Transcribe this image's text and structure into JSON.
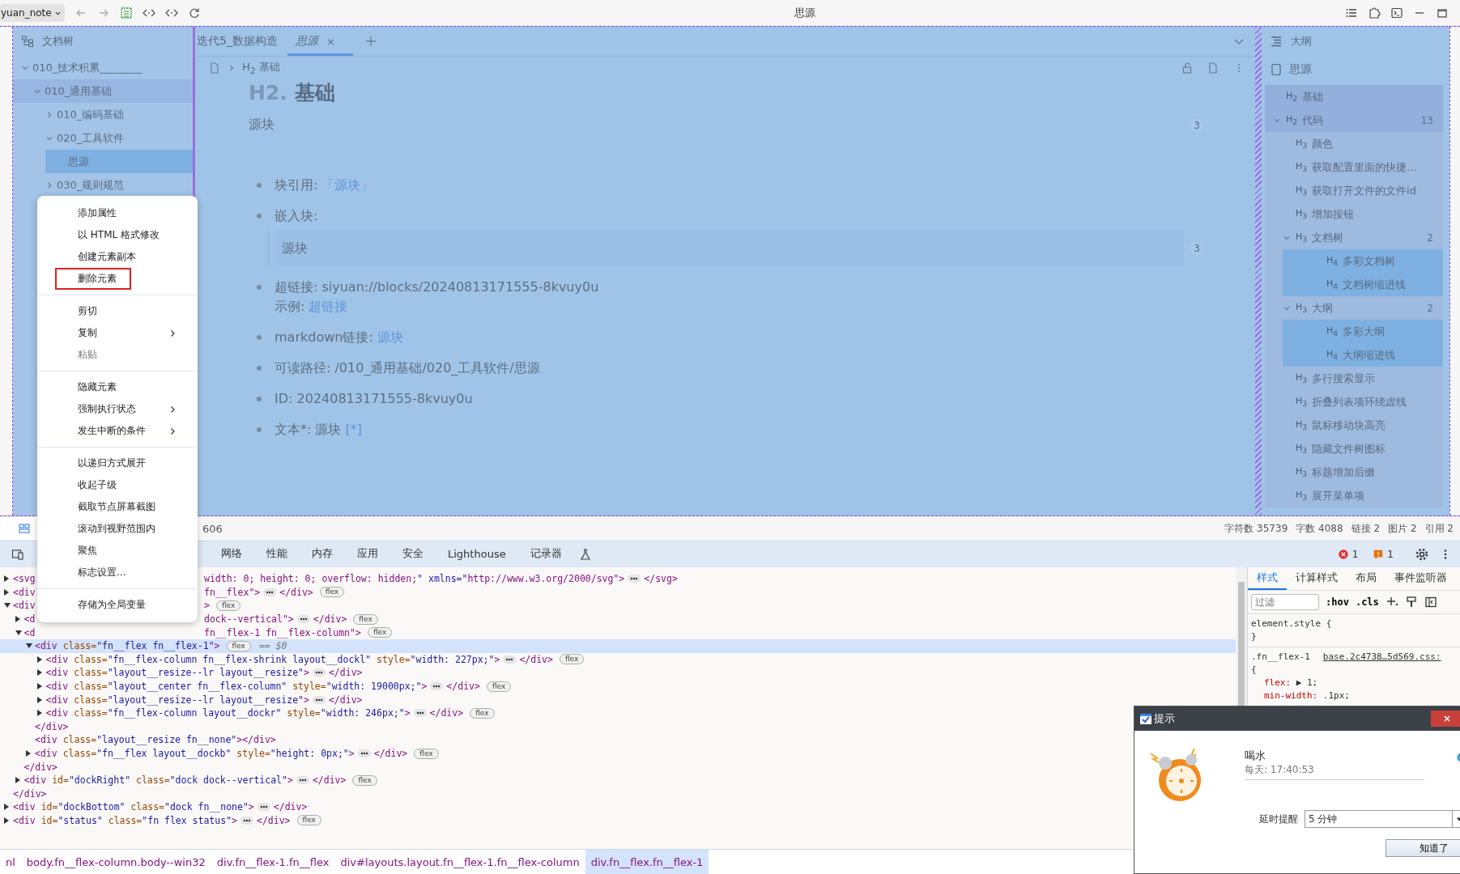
{
  "topbar": {
    "workspace": "yuan_note",
    "title": "思源"
  },
  "doc_tree": {
    "title": "文档树",
    "items": [
      {
        "label": "010_技术积累________",
        "expanded": true,
        "selected": false,
        "children": [
          {
            "label": "010_通用基础",
            "expanded": true,
            "selected": false,
            "children": [
              {
                "label": "010_编码基础",
                "expanded": false,
                "selected": false
              },
              {
                "label": "020_工具软件",
                "expanded": true,
                "selected": false,
                "children": [
                  {
                    "label": "思源",
                    "selected": true
                  }
                ]
              },
              {
                "label": "030_规则规范",
                "expanded": false,
                "selected": false
              }
            ]
          }
        ]
      }
    ]
  },
  "editor": {
    "tabs": [
      {
        "label": "迭代5_数据构造",
        "selected": false
      },
      {
        "label": "思源",
        "selected": true,
        "close": "×"
      }
    ],
    "breadcrumb": {
      "level": "H$_{2}$",
      "label": "基础"
    },
    "heading": {
      "marker": "H2.",
      "text": "基础"
    },
    "paragraph": {
      "text": "源块",
      "count": "3"
    },
    "list": [
      {
        "kind": "link",
        "label": "块引用: ",
        "link": "「源块」"
      },
      {
        "kind": "embed",
        "label": "嵌入块:",
        "embed": "源块",
        "count": "3"
      },
      {
        "kind": "note",
        "label": "超链接: siyuan://blocks/20240813171555-8kvuy0u",
        "note": "示例: ",
        "link": "超链接"
      },
      {
        "kind": "link",
        "label": "markdown链接: ",
        "link": "源块"
      },
      {
        "kind": "text",
        "label": "可读路径: /010_通用基础/020_工具软件/思源"
      },
      {
        "kind": "text",
        "label": "ID: 20240813171555-8kvuy0u"
      },
      {
        "kind": "link",
        "label": "文本*: 源块 ",
        "link": "[*]"
      }
    ]
  },
  "outline": {
    "title": "大纲",
    "doc": "思源",
    "items": [
      {
        "tag": "H$_{2}$",
        "label": "基础",
        "selected": false
      },
      {
        "tag": "H$_{2}$",
        "label": "代码",
        "count": "13",
        "expanded": true,
        "selected": false,
        "children": [
          {
            "tag": "H$_{3}$",
            "label": "颜色",
            "selected": false
          },
          {
            "tag": "H$_{3}$",
            "label": "获取配置里面的快捷…",
            "selected": false
          },
          {
            "tag": "H$_{3}$",
            "label": "获取打开文件的文件id",
            "selected": false
          },
          {
            "tag": "H$_{3}$",
            "label": "增加按钮",
            "selected": false
          },
          {
            "tag": "H$_{3}$",
            "label": "文档树",
            "count": "2",
            "expanded": true,
            "selected": false,
            "children": [
              {
                "tag": "H$_{4}$",
                "label": "多彩文档树",
                "selected": true
              },
              {
                "tag": "H$_{4}$",
                "label": "文档树缩进线",
                "selected": true
              }
            ]
          },
          {
            "tag": "H$_{3}$",
            "label": "大纲",
            "count": "2",
            "expanded": true,
            "selected": false,
            "children": [
              {
                "tag": "H$_{4}$",
                "label": "多彩大纲",
                "selected": true
              },
              {
                "tag": "H$_{4}$",
                "label": "大纲缩进线",
                "selected": true
              }
            ]
          },
          {
            "tag": "H$_{3}$",
            "label": "多行搜索显示",
            "selected": false
          },
          {
            "tag": "H$_{3}$",
            "label": "折叠列表项环绕虚线",
            "selected": false
          },
          {
            "tag": "H$_{3}$",
            "label": "鼠标移动块高亮",
            "selected": false
          },
          {
            "tag": "H$_{3}$",
            "label": "隐藏文件树图标",
            "selected": false
          },
          {
            "tag": "H$_{3}$",
            "label": "标题增加后缀",
            "selected": false
          },
          {
            "tag": "H$_{3}$",
            "label": "展开菜单项",
            "selected": false
          }
        ]
      }
    ]
  },
  "status": {
    "size": "606",
    "stats": [
      "字符数 35739",
      "字数 4088",
      "链接 2",
      "图片 2",
      "引用 2"
    ]
  },
  "devtools": {
    "tabs": [
      {
        "label": "网络",
        "selected": false
      },
      {
        "label": "性能",
        "selected": false
      },
      {
        "label": "内存",
        "selected": false
      },
      {
        "label": "应用",
        "selected": false
      },
      {
        "label": "安全",
        "selected": false
      },
      {
        "label": "Lighthouse",
        "selected": false
      },
      {
        "label": "记录器",
        "selected": false
      }
    ],
    "errors": "1",
    "warnings": "1",
    "dom": [
      {
        "left": "<svg",
        "right": "width: 0; height: 0; overflow: hidden;\" xmlns=\"http://www.w3.org/2000/svg\">",
        "expanded": false,
        "more": true,
        "end": "</svg>",
        "selected": false
      },
      {
        "left": "<div",
        "right": "fn__flex\">",
        "expanded": false,
        "more": true,
        "end": "</div>",
        "badge": "flex",
        "selected": false
      },
      {
        "left": "<div",
        "right": ">",
        "expanded": true,
        "badge": "flex",
        "selected": false,
        "close": "</div>",
        "children": [
          {
            "left": "<d",
            "right": "dock--vertical\">",
            "expanded": false,
            "more": true,
            "end": "</div>",
            "badge": "flex",
            "selected": false
          },
          {
            "left": "<d",
            "right": "fn__flex-1 fn__flex-column\">",
            "expanded": true,
            "badge": "flex",
            "selected": false,
            "close": "</div>",
            "children": [
              {
                "text": "<div class=\"fn__flex fn__flex-1\">",
                "expanded": true,
                "badge": "flex",
                "marker": "== $0",
                "selected": true,
                "close": "</div>",
                "children": [
                  {
                    "text": "<div class=\"fn__flex-column fn__flex-shrink layout__dockl\" style=\"width: 227px;\">",
                    "expanded": false,
                    "more": true,
                    "end": "</div>",
                    "badge": "flex",
                    "selected": false
                  },
                  {
                    "text": "<div class=\"layout__resize--lr layout__resize\">",
                    "expanded": false,
                    "more": true,
                    "end": "</div>",
                    "selected": false
                  },
                  {
                    "text": "<div class=\"layout__center fn__flex-column\" style=\"width: 19000px;\">",
                    "expanded": false,
                    "more": true,
                    "end": "</div>",
                    "badge": "flex",
                    "selected": false
                  },
                  {
                    "text": "<div class=\"layout__resize--lr layout__resize\">",
                    "expanded": false,
                    "more": true,
                    "end": "</div>",
                    "selected": false
                  },
                  {
                    "text": "<div class=\"fn__flex-column layout__dockr\" style=\"width: 246px;\">",
                    "expanded": false,
                    "more": true,
                    "end": "</div>",
                    "badge": "flex",
                    "selected": false
                  }
                ]
              },
              {
                "text": "<div class=\"layout__resize fn__none\"></div>",
                "selected": false
              },
              {
                "text": "<div class=\"fn__flex layout__dockb\" style=\"height: 0px;\">",
                "expanded": false,
                "more": true,
                "end": "</div>",
                "badge": "flex",
                "selected": false
              }
            ]
          },
          {
            "text": "<div id=\"dockRight\" class=\"dock dock--vertical\">",
            "expanded": false,
            "more": true,
            "end": "</div>",
            "badge": "flex",
            "selected": false
          }
        ]
      },
      {
        "text": "<div id=\"dockBottom\" class=\"dock fn__none\">",
        "expanded": false,
        "more": true,
        "end": "</div>",
        "selected": false
      },
      {
        "text": "<div id=\"status\" class=\"fn flex status\">",
        "expanded": false,
        "more": true,
        "end": "</div>",
        "badge": "flex",
        "selected": false
      }
    ],
    "styles": {
      "tabs": [
        {
          "label": "样式",
          "selected": true
        },
        {
          "label": "计算样式",
          "selected": false
        },
        {
          "label": "布局",
          "selected": false
        },
        {
          "label": "事件监听器",
          "selected": false
        }
      ],
      "filter_placeholder": "过滤",
      "hov": ":hov",
      "cls": ".cls",
      "rules": [
        {
          "selector": "element.style {",
          "close": "}"
        },
        {
          "selector": ".fn__flex-1",
          "source": "base.2c4738…5d569.css:",
          "open": "{",
          "props": [
            {
              "name": "flex:",
              "value": "▶ 1;"
            },
            {
              "name": "min-width:",
              "value": ".1px;"
            }
          ]
        }
      ]
    },
    "breadcrumb": [
      {
        "label": "nl",
        "selected": false
      },
      {
        "label": "body.fn__flex-column.body--win32",
        "selected": false
      },
      {
        "label": "div.fn__flex-1.fn__flex",
        "selected": false
      },
      {
        "label": "div#layouts.layout.fn__flex-1.fn__flex-column",
        "selected": false
      },
      {
        "label": "div.fn__flex.fn__flex-1",
        "selected": true
      }
    ]
  },
  "context_menu": [
    [
      {
        "label": "添加属性",
        "highlighted": false,
        "disabled": false
      },
      {
        "label": "以 HTML 格式修改",
        "highlighted": false,
        "disabled": false
      },
      {
        "label": "创建元素副本",
        "highlighted": false,
        "disabled": false
      },
      {
        "label": "删除元素",
        "highlighted": true,
        "disabled": false
      }
    ],
    [
      {
        "label": "剪切",
        "highlighted": false,
        "disabled": false
      },
      {
        "label": "复制",
        "submenu": true,
        "highlighted": false,
        "disabled": false
      },
      {
        "label": "粘贴",
        "highlighted": false,
        "disabled": true
      }
    ],
    [
      {
        "label": "隐藏元素",
        "highlighted": false,
        "disabled": false
      },
      {
        "label": "强制执行状态",
        "submenu": true,
        "highlighted": false,
        "disabled": false
      },
      {
        "label": "发生中断的条件",
        "submenu": true,
        "highlighted": false,
        "disabled": false
      }
    ],
    [
      {
        "label": "以递归方式展开",
        "highlighted": false,
        "disabled": false
      },
      {
        "label": "收起子级",
        "highlighted": false,
        "disabled": false
      },
      {
        "label": "截取节点屏幕截图",
        "highlighted": false,
        "disabled": false
      },
      {
        "label": "滚动到视野范围内",
        "highlighted": false,
        "disabled": false
      },
      {
        "label": "聚焦",
        "highlighted": false,
        "disabled": false
      },
      {
        "label": "标志设置...",
        "highlighted": false,
        "disabled": false
      }
    ],
    [
      {
        "label": "存储为全局变量",
        "highlighted": false,
        "disabled": false
      }
    ]
  ],
  "reminder": {
    "title": "提示",
    "name": "喝水",
    "schedule": "每天: 17:40:53",
    "delay_label": "延时提醒",
    "delay_value": "5 分钟",
    "button": "知道了"
  }
}
